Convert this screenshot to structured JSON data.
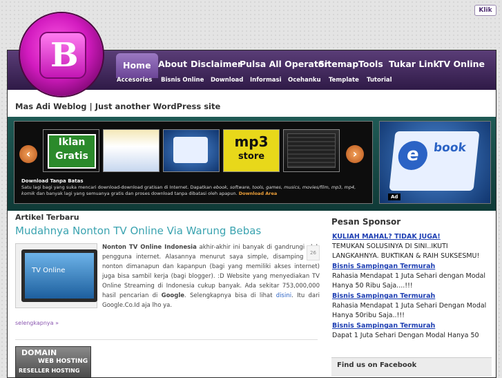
{
  "corner_button": "Klik",
  "nav": {
    "main": [
      "Home",
      "About",
      "Disclaimer",
      "Pulsa All Operator",
      "Sitemap",
      "Tools",
      "Tukar Link",
      "TV Online"
    ],
    "sub": [
      "Accesories",
      "Bisnis Online",
      "Download",
      "Informasi",
      "Ocehanku",
      "Template",
      "Tutorial"
    ]
  },
  "site": {
    "tagline": "Mas Adi Weblog | Just another WordPress site"
  },
  "slider": {
    "thumb1": [
      "Iklan",
      "Gratis"
    ],
    "thumb4": [
      "mp3",
      "store"
    ],
    "title": "Download Tanpa Batas",
    "desc_prefix": "Satu lagi bagi yang suka mencari download-download gratisan di Internet. Dapatkan ",
    "desc_italic1": "ebook, software, tools, games, musics, movies/film, mp3, mp4, komik",
    "desc_suffix": " dan banyak lagi yang semuanya gratis dan proses download tanpa dibatasi oleh apapun. ",
    "desc_link": "Download Area",
    "ad_label": "Ad",
    "book_text": "book"
  },
  "main": {
    "section_label": "Artikel Terbaru",
    "post_title": "Mudahnya Nonton TV Online Via Warung Bebas",
    "thumb_text": "TV Online",
    "date": "26",
    "body_bold": "Nonton TV Online Indonesia",
    "body_1": " akhir-akhir ini banyak di gandrungi oleh pengguna internet. Alasannya menurut saya simple, disamping bisa nonton dimanapun dan kapanpun (bagi yang memiliki akses internet) juga bisa sambil kerja (bagi blogger). :D Website yang menyediakan TV Online Streaming di Indonesia cukup banyak. Ada sekitar 753,000,000 hasil pencarian di ",
    "body_bold2": "Google",
    "body_2": ". Selengkapnya bisa di lihat ",
    "body_link": "disini",
    "body_3": ". Itu dari Google.Co.Id aja lho ya.",
    "readmore": "selengkapnya »",
    "banner": [
      "DOMAIN",
      "WEB HOSTING",
      "RESELLER HOSTING"
    ]
  },
  "sidebar": {
    "title": "Pesan Sponsor",
    "ads": [
      {
        "link": "KULIAH MAHAL? TIDAK JUGA!",
        "text": "TEMUKAN SOLUSINYA DI SINI..IKUTI LANGKAHNYA. BUKTIKAN & RAIH SUKSESMU!"
      },
      {
        "link": "Bisnis Sampingan Termurah",
        "text": "Rahasia Mendapat 1 Juta Sehari dengan Modal Hanya 50 Ribu Saja....!!!"
      },
      {
        "link": "Bisnis Sampingan Termurah",
        "text": "Rahasia Mendapat 1 Juta Sehari Dengan Modal Hanya 50ribu Saja..!!!"
      },
      {
        "link": "Bisnis Sampingan Termurah",
        "text": "Dapat 1 Juta Sehari Dengan Modal Hanya 50"
      }
    ],
    "facebook": "Find us on Facebook"
  }
}
